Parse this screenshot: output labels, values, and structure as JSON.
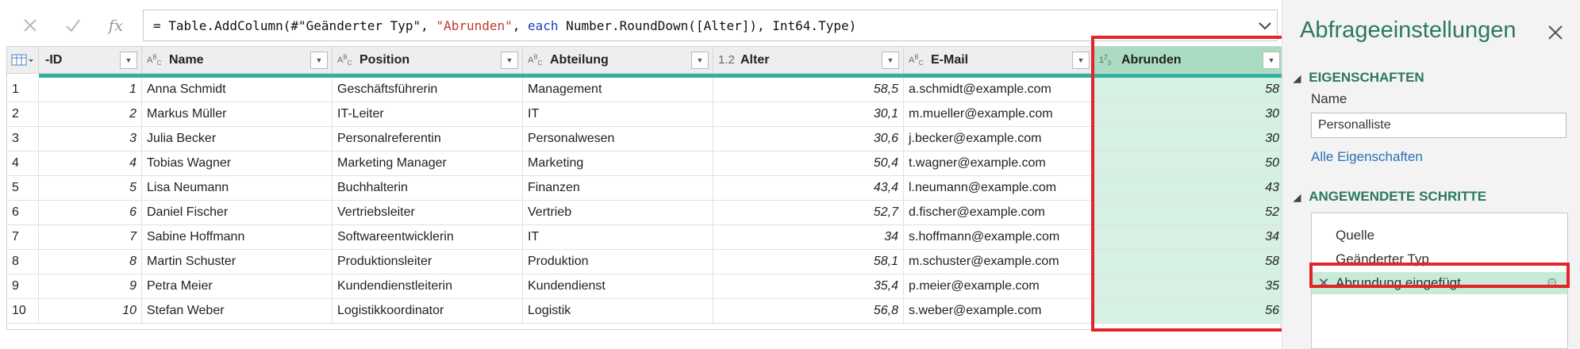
{
  "formula_bar": {
    "cancel_icon": "close-icon",
    "confirm_icon": "check-icon",
    "fx_label": "fx",
    "formula_parts": [
      {
        "text": "= Table.AddColumn(#\"Geänderter Typ\", ",
        "style": "n"
      },
      {
        "text": "\"Abrunden\"",
        "style": "s"
      },
      {
        "text": ", ",
        "style": "n"
      },
      {
        "text": "each",
        "style": "k"
      },
      {
        "text": " Number.RoundDown([Alter]), Int64.Type)",
        "style": "n"
      }
    ]
  },
  "table": {
    "columns": [
      {
        "type": "",
        "name": "-ID"
      },
      {
        "type": "ABC",
        "name": "Name"
      },
      {
        "type": "ABC",
        "name": "Position"
      },
      {
        "type": "ABC",
        "name": "Abteilung"
      },
      {
        "type": "1.2",
        "name": "Alter"
      },
      {
        "type": "ABC",
        "name": "E-Mail"
      },
      {
        "type": "123",
        "name": "Abrunden"
      }
    ],
    "rows": [
      [
        "1",
        "Anna Schmidt",
        "Geschäftsführerin",
        "Management",
        "58,5",
        "a.schmidt@example.com",
        "58"
      ],
      [
        "2",
        "Markus Müller",
        "IT-Leiter",
        "IT",
        "30,1",
        "m.mueller@example.com",
        "30"
      ],
      [
        "3",
        "Julia Becker",
        "Personalreferentin",
        "Personalwesen",
        "30,6",
        "j.becker@example.com",
        "30"
      ],
      [
        "4",
        "Tobias Wagner",
        "Marketing Manager",
        "Marketing",
        "50,4",
        "t.wagner@example.com",
        "50"
      ],
      [
        "5",
        "Lisa Neumann",
        "Buchhalterin",
        "Finanzen",
        "43,4",
        "l.neumann@example.com",
        "43"
      ],
      [
        "6",
        "Daniel Fischer",
        "Vertriebsleiter",
        "Vertrieb",
        "52,7",
        "d.fischer@example.com",
        "52"
      ],
      [
        "7",
        "Sabine Hoffmann",
        "Softwareentwicklerin",
        "IT",
        "34",
        "s.hoffmann@example.com",
        "34"
      ],
      [
        "8",
        "Martin Schuster",
        "Produktionsleiter",
        "Produktion",
        "58,1",
        "m.schuster@example.com",
        "58"
      ],
      [
        "9",
        "Petra Meier",
        "Kundendienstleiterin",
        "Kundendienst",
        "35,4",
        "p.meier@example.com",
        "35"
      ],
      [
        "10",
        "Stefan Weber",
        "Logistikkoordinator",
        "Logistik",
        "56,8",
        "s.weber@example.com",
        "56"
      ]
    ],
    "selected_column": "Abrunden"
  },
  "settings_pane": {
    "title": "Abfrageeinstellungen",
    "properties_header": "EIGENSCHAFTEN",
    "name_label": "Name",
    "name_value": "Personalliste",
    "all_properties_link": "Alle Eigenschaften",
    "steps_header": "ANGEWENDETE SCHRITTE",
    "steps": [
      {
        "label": "Quelle",
        "active": false
      },
      {
        "label": "Geänderter Typ",
        "active": false
      },
      {
        "label": "Abrundung eingefügt",
        "active": true
      }
    ]
  },
  "colors": {
    "accent": "#2b7a58",
    "highlight": "#e3242b",
    "selected_column": "#d6f0e2"
  }
}
